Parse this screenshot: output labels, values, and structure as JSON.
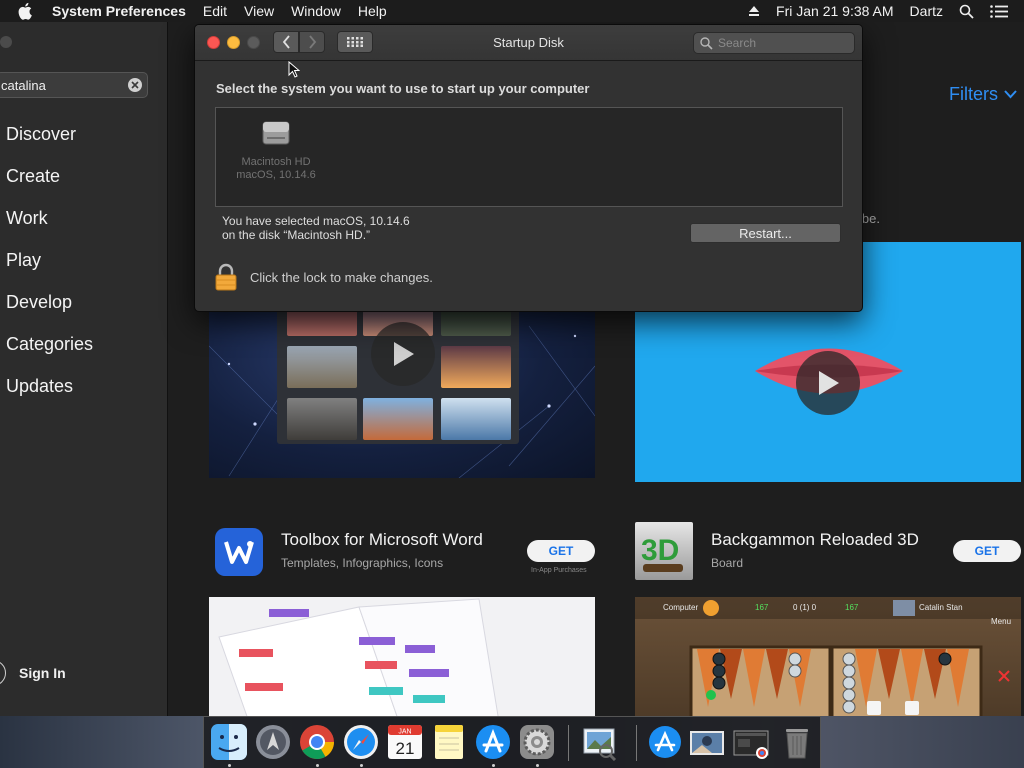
{
  "menubar": {
    "app_name": "System Preferences",
    "menus": [
      "Edit",
      "View",
      "Window",
      "Help"
    ],
    "datetime": "Fri Jan 21  9:38 AM",
    "user": "Dartz",
    "icons": [
      "apple-icon",
      "eject-icon",
      "spotlight-search-icon",
      "notification-center-icon"
    ]
  },
  "appstore": {
    "search_value": "catalina",
    "nav": [
      "Discover",
      "Create",
      "Work",
      "Play",
      "Develop",
      "Categories",
      "Updates"
    ],
    "sign_in": "Sign In",
    "filters_label": "Filters",
    "subtitle_tail": "ibe.",
    "apps": [
      {
        "name": "Toolbox for Microsoft Word",
        "subtitle": "Templates, Infographics, Icons",
        "button": "GET",
        "note": "In-App Purchases"
      },
      {
        "name": "Backgammon Reloaded 3D",
        "subtitle": "Board",
        "button": "GET"
      }
    ],
    "backgammon_preview": {
      "player1": "Computer",
      "score_left": "167",
      "match": "0 (1) 0",
      "score_right": "167",
      "player2": "Catalin Stan",
      "menu": "Menu"
    }
  },
  "startup_disk": {
    "title": "Startup Disk",
    "search_placeholder": "Search",
    "instruction": "Select the system you want to use to start up your computer",
    "disk_name": "Macintosh HD",
    "disk_os": "macOS, 10.14.6",
    "selected_line1": "You have selected macOS, 10.14.6",
    "selected_line2": "on the disk “Macintosh HD.”",
    "restart_label": "Restart...",
    "lock_text": "Click the lock to make changes.",
    "colors": {
      "close": "#fc5753",
      "minimize": "#fdbc40",
      "zoom": "#5b5b5b"
    }
  },
  "dock": {
    "apps": [
      "finder",
      "launchpad",
      "chrome",
      "safari",
      "calendar",
      "notes",
      "app-store",
      "system-preferences",
      "preview",
      "app-store-downloads",
      "photo-stack",
      "screenshot-stack",
      "trash"
    ],
    "calendar_month": "JAN",
    "calendar_day": "21"
  }
}
